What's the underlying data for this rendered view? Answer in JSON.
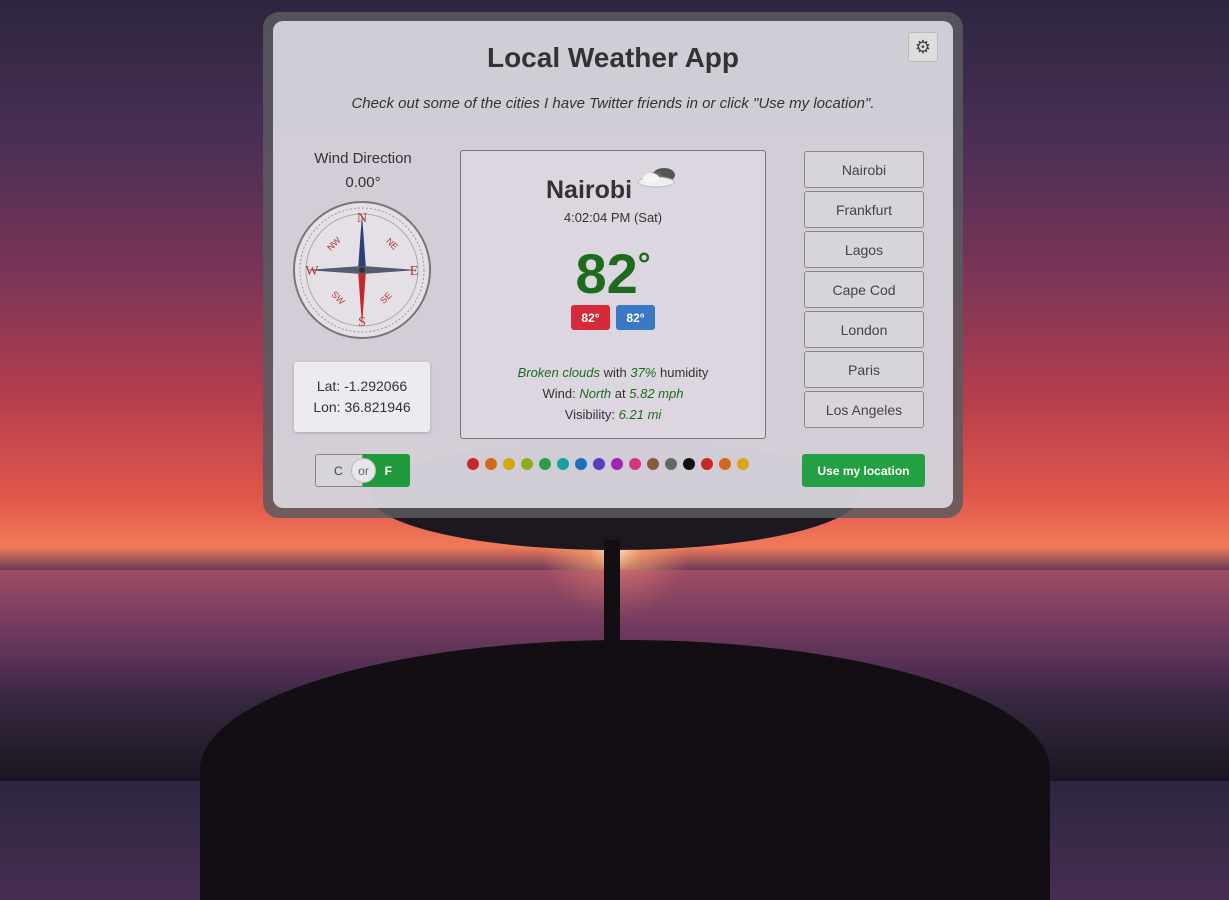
{
  "app": {
    "title": "Local Weather App",
    "subtitle": "Check out some of the cities I have Twitter friends in or click \"Use my location\"."
  },
  "settings": {
    "icon": "gear-icon"
  },
  "wind": {
    "title": "Wind Direction",
    "degrees": "0.00°",
    "compass_labels": {
      "n": "N",
      "s": "S",
      "e": "E",
      "w": "W",
      "ne": "NE",
      "nw": "NW",
      "se": "SE",
      "sw": "SW"
    }
  },
  "coords": {
    "lat": "Lat: -1.292066",
    "lon": "Lon: 36.821946"
  },
  "weather": {
    "city": "Nairobi",
    "icon": "broken-clouds-icon",
    "time": "4:02:04 PM (Sat)",
    "temp": "82",
    "degree_symbol": "°",
    "badge_red": "82°",
    "badge_blue": "82°",
    "condition": "Broken clouds",
    "with_text": "with",
    "humidity": "37%",
    "humidity_text": "humidity",
    "wind_label": "Wind:",
    "wind_dir": "North",
    "at_text": "at",
    "wind_speed": "5.82 mph",
    "visibility_label": "Visibility:",
    "visibility": "6.21 mi"
  },
  "cities": [
    "Nairobi",
    "Frankfurt",
    "Lagos",
    "Cape Cod",
    "London",
    "Paris",
    "Los Angeles"
  ],
  "units": {
    "c": "C",
    "or": "or",
    "f": "F",
    "selected": "F"
  },
  "swatch_colors": [
    "#c62828",
    "#d9641a",
    "#d9a41a",
    "#8fae1b",
    "#2e9e44",
    "#17a2a0",
    "#1f6fb8",
    "#5b3bbd",
    "#9c27b0",
    "#d63384",
    "#8b5a3c",
    "#666666",
    "#111111",
    "#c62828",
    "#d9641a",
    "#d9a41a"
  ],
  "location_button": "Use my location",
  "colors": {
    "accent_green": "#22a043",
    "temp_green": "#1e6b1e",
    "badge_red": "#d62a3a",
    "badge_blue": "#3a78c4"
  }
}
